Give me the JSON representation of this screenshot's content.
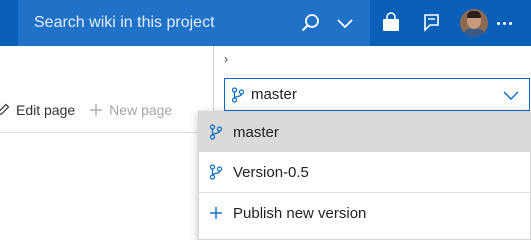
{
  "header": {
    "search_placeholder": "Search wiki in this project",
    "icons": [
      "search-icon",
      "chevron-down-icon",
      "marketplace-bag-icon",
      "feedback-icon",
      "avatar",
      "more-icon"
    ]
  },
  "toolbar": {
    "edit_label": "Edit page",
    "new_label": "New page"
  },
  "branch_selector": {
    "expand_glyph": "›",
    "current": "master"
  },
  "dropdown": {
    "items": [
      {
        "label": "master",
        "selected": true
      },
      {
        "label": "Version-0.5",
        "selected": false
      }
    ],
    "publish_label": "Publish new version"
  },
  "colors": {
    "header_bg": "#0a5fb8",
    "search_bg": "#1f72c8",
    "accent": "#0a6acb",
    "selected_bg": "#dadada"
  }
}
